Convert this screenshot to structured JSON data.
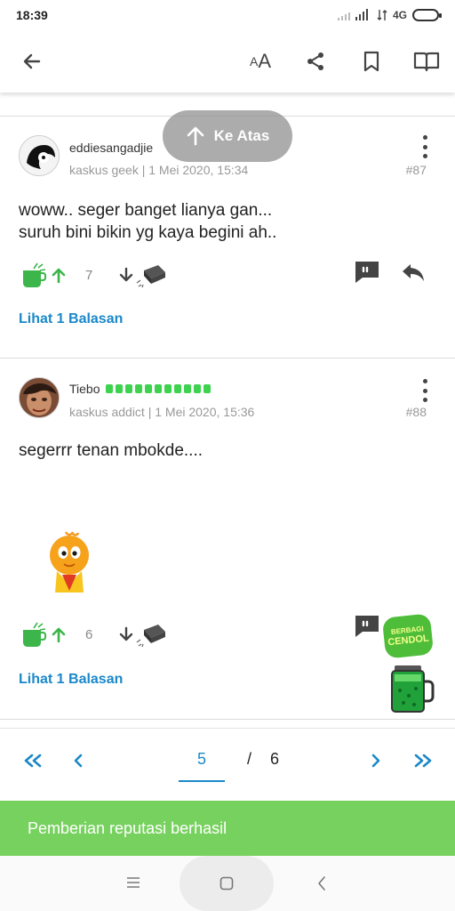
{
  "status_bar": {
    "time": "18:39",
    "network": "4G"
  },
  "app_bar": {
    "back_icon": "arrow-left-icon",
    "text_size_label": "AA",
    "share_icon": "share-icon",
    "bookmark_icon": "bookmark-icon",
    "reader_icon": "book-open-icon"
  },
  "scroll_top": {
    "label": "Ke Atas",
    "icon": "arrow-up-icon"
  },
  "posts": [
    {
      "username": "eddiesangadjie",
      "meta": "kaskus geek | 1 Mei 2020, 15:34",
      "number": "#87",
      "body_line1": "woww.. seger banget lianya gan...",
      "body_line2": "suruh bini bikin yg kaya begini ah..",
      "cendol_count": "7",
      "replies_link": "Lihat 1 Balasan"
    },
    {
      "username": "Tiebo",
      "meta": "kaskus addict | 1 Mei 2020, 15:36",
      "number": "#88",
      "body_line1": "segerrr tenan mbokde....",
      "cendol_count": "6",
      "replies_link": "Lihat 1 Balasan",
      "cendol_badge_line1": "BERBAGI",
      "cendol_badge_line2": "CENDOL"
    }
  ],
  "pagination": {
    "current": "5",
    "separator": "/",
    "total": "6"
  },
  "toast": {
    "message": "Pemberian reputasi berhasil"
  },
  "colors": {
    "accent": "#1a88c9",
    "green": "#3cb54a",
    "toast": "#77d15f"
  }
}
